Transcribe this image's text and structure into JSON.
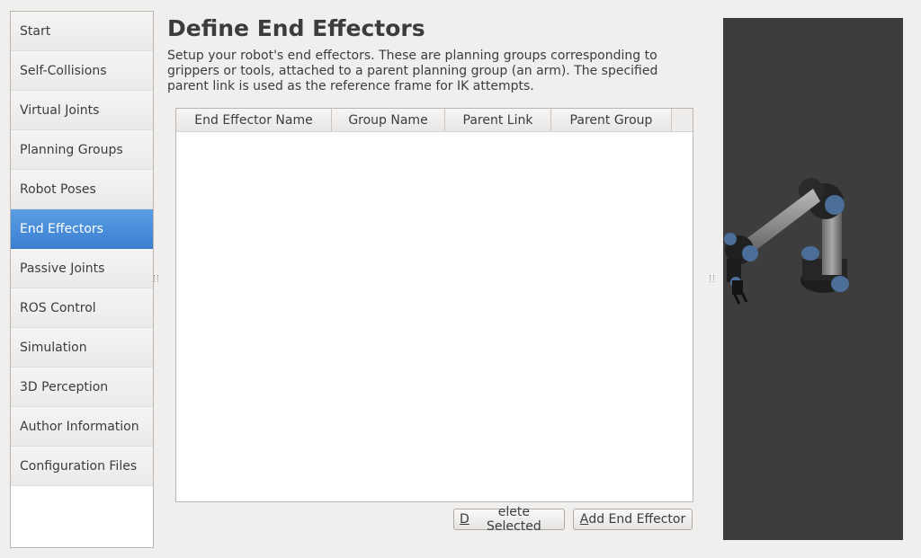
{
  "sidebar": {
    "items": [
      {
        "label": "Start"
      },
      {
        "label": "Self-Collisions"
      },
      {
        "label": "Virtual Joints"
      },
      {
        "label": "Planning Groups"
      },
      {
        "label": "Robot Poses"
      },
      {
        "label": "End Effectors",
        "active": true
      },
      {
        "label": "Passive Joints"
      },
      {
        "label": "ROS Control"
      },
      {
        "label": "Simulation"
      },
      {
        "label": "3D Perception"
      },
      {
        "label": "Author Information"
      },
      {
        "label": "Configuration Files"
      }
    ]
  },
  "page": {
    "title": "Define End Effectors",
    "description": "Setup your robot's end effectors. These are planning groups corresponding to grippers or tools, attached to a parent planning group (an arm). The specified parent link is used as the reference frame for IK attempts."
  },
  "table": {
    "columns": [
      "End Effector Name",
      "Group Name",
      "Parent Link",
      "Parent Group"
    ],
    "rows": []
  },
  "buttons": {
    "delete_mnemonic": "D",
    "delete_rest": "elete Selected",
    "add_mnemonic": "A",
    "add_rest": "dd End Effector"
  },
  "colors": {
    "active_item": "#3c7fd1",
    "viewer_background": "#3d3d3d"
  }
}
